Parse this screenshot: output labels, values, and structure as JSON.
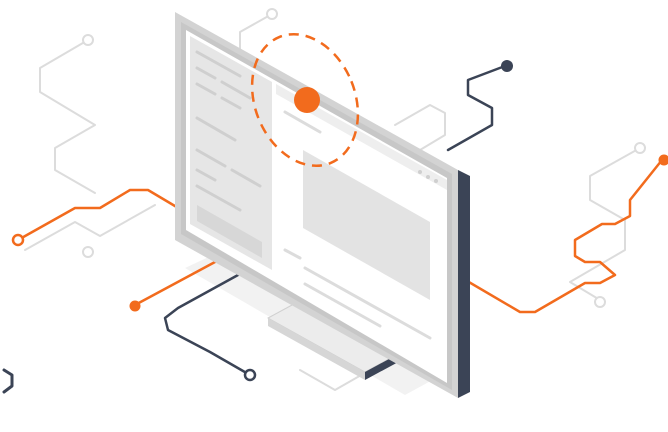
{
  "illustration": {
    "subject": "isometric-monitor-with-network-lines",
    "colors": {
      "background": "#ffffff",
      "accent": "#f26b1d",
      "navy": "#3b4456",
      "light_line": "#d8d8d8",
      "screen_bg": "#ffffff",
      "screen_panel": "#e7e7e7",
      "frame_light": "#d9d9d9",
      "frame_mid": "#bdbdbd",
      "frame_dark": "#3b4456"
    },
    "icons": [
      "target-dot-icon",
      "dashed-orbit-icon",
      "connector-node-icon"
    ]
  }
}
